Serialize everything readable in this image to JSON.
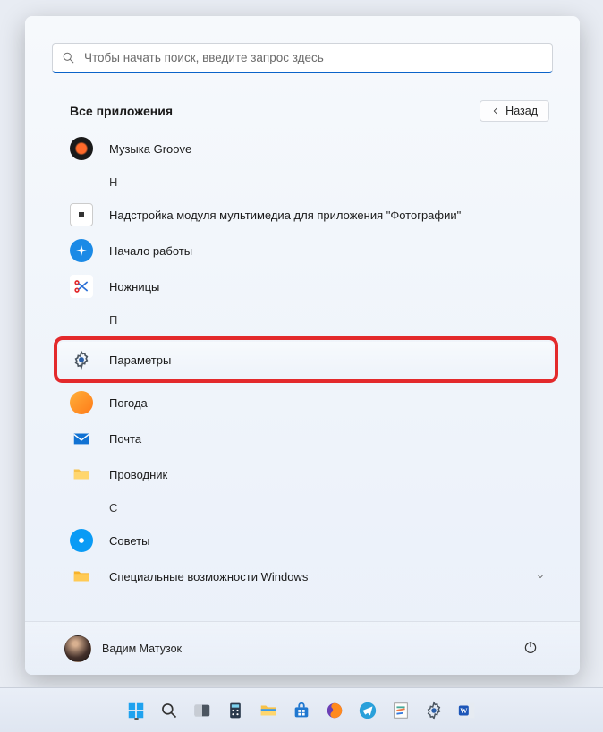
{
  "search": {
    "placeholder": "Чтобы начать поиск, введите запрос здесь"
  },
  "header": {
    "title": "Все приложения",
    "back": "Назад"
  },
  "apps": {
    "groove": "Музыка Groove",
    "letter_n": "Н",
    "photos_addon": "Надстройка модуля мультимедиа для приложения \"Фотографии\"",
    "getstarted": "Начало работы",
    "snip": "Ножницы",
    "letter_p": "П",
    "settings": "Параметры",
    "weather": "Погода",
    "mail": "Почта",
    "explorer": "Проводник",
    "letter_s": "С",
    "tips": "Советы",
    "accessibility": "Специальные возможности Windows"
  },
  "user": {
    "name": "Вадим Матузок"
  },
  "taskbar": {
    "items": [
      "start",
      "search",
      "taskview",
      "calculator",
      "explorer",
      "store",
      "firefox",
      "telegram",
      "notes",
      "settings",
      "word"
    ]
  }
}
